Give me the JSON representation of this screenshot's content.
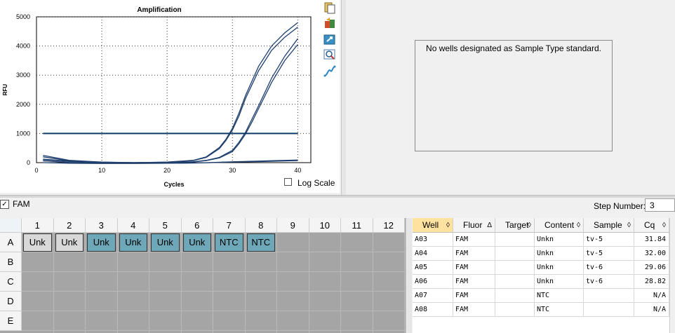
{
  "chart": {
    "title": "Amplification",
    "ylabel": "RFU",
    "xlabel": "Cycles",
    "y_ticks": [
      "5000",
      "4000",
      "3000",
      "2000",
      "1000",
      "0"
    ],
    "x_ticks": [
      "0",
      "10",
      "20",
      "30",
      "40"
    ],
    "log_scale_label": "Log Scale",
    "log_scale_checked": false,
    "threshold": 1000,
    "line_color": "#1f3f6e"
  },
  "chart_data": {
    "type": "line",
    "title": "Amplification",
    "xlabel": "Cycles",
    "ylabel": "RFU",
    "xlim": [
      0,
      42
    ],
    "ylim": [
      0,
      5000
    ],
    "grid": true,
    "threshold": 1000,
    "series": [
      {
        "x": [
          1,
          5,
          10,
          15,
          20,
          24,
          26,
          28,
          29,
          30,
          31,
          32,
          34,
          36,
          38,
          40
        ],
        "y": [
          120,
          50,
          10,
          0,
          20,
          80,
          200,
          520,
          800,
          1180,
          1700,
          2300,
          3300,
          4000,
          4450,
          4800
        ]
      },
      {
        "x": [
          1,
          5,
          10,
          15,
          20,
          24,
          26,
          28,
          29,
          30,
          31,
          32,
          34,
          36,
          38,
          40
        ],
        "y": [
          100,
          40,
          5,
          0,
          15,
          70,
          180,
          480,
          760,
          1120,
          1600,
          2200,
          3150,
          3850,
          4300,
          4650
        ]
      },
      {
        "x": [
          1,
          5,
          10,
          15,
          20,
          24,
          26,
          28,
          30,
          31,
          32,
          33,
          34,
          36,
          38,
          40
        ],
        "y": [
          250,
          80,
          20,
          0,
          10,
          30,
          80,
          180,
          420,
          700,
          1040,
          1500,
          1950,
          2900,
          3650,
          4250
        ]
      },
      {
        "x": [
          1,
          5,
          10,
          15,
          20,
          24,
          26,
          28,
          30,
          31,
          32,
          33,
          34,
          36,
          38,
          40
        ],
        "y": [
          200,
          60,
          15,
          0,
          10,
          25,
          70,
          160,
          380,
          650,
          980,
          1400,
          1850,
          2750,
          3500,
          4050
        ]
      },
      {
        "x": [
          1,
          5,
          10,
          15,
          20,
          25,
          30,
          35,
          40
        ],
        "y": [
          0,
          -20,
          -30,
          -30,
          -20,
          -10,
          30,
          60,
          90
        ]
      },
      {
        "x": [
          1,
          5,
          10,
          15,
          20,
          25,
          30,
          35,
          40
        ],
        "y": [
          60,
          10,
          -10,
          -20,
          -20,
          -10,
          20,
          40,
          70
        ]
      }
    ]
  },
  "standard_panel": {
    "message": "No wells designated as Sample Type standard."
  },
  "fluor_filter": {
    "label": "FAM",
    "checked": true
  },
  "step": {
    "label": "Step Number:",
    "value": "3"
  },
  "plate": {
    "columns": [
      "1",
      "2",
      "3",
      "4",
      "5",
      "6",
      "7",
      "8",
      "9",
      "10",
      "11",
      "12"
    ],
    "rows": [
      "A",
      "B",
      "C",
      "D",
      "E"
    ],
    "wells": [
      {
        "label": "Unk",
        "style": "unk-grey"
      },
      {
        "label": "Unk",
        "style": "unk-grey"
      },
      {
        "label": "Unk",
        "style": "unk-teal"
      },
      {
        "label": "Unk",
        "style": "unk-teal"
      },
      {
        "label": "Unk",
        "style": "unk-teal"
      },
      {
        "label": "Unk",
        "style": "unk-teal"
      },
      {
        "label": "NTC",
        "style": "ntc"
      },
      {
        "label": "NTC",
        "style": "ntc"
      }
    ]
  },
  "table": {
    "headers": [
      "Well",
      "Fluor",
      "Target",
      "Content",
      "Sample",
      "Cq"
    ],
    "sort_glyphs": [
      "◊",
      "Δ",
      "◊",
      "◊",
      "◊",
      "◊"
    ],
    "rows": [
      [
        "A03",
        "FAM",
        "",
        "Unkn",
        "tv-5",
        "31.84"
      ],
      [
        "A04",
        "FAM",
        "",
        "Unkn",
        "tv-5",
        "32.00"
      ],
      [
        "A05",
        "FAM",
        "",
        "Unkn",
        "tv-6",
        "29.06"
      ],
      [
        "A06",
        "FAM",
        "",
        "Unkn",
        "tv-6",
        "28.82"
      ],
      [
        "A07",
        "FAM",
        "",
        "NTC",
        "",
        "N/A"
      ],
      [
        "A08",
        "FAM",
        "",
        "NTC",
        "",
        "N/A"
      ]
    ]
  },
  "toolbar_icons": [
    "copy-icon",
    "export-icon",
    "refresh-icon",
    "zoom-icon",
    "curve-icon"
  ]
}
